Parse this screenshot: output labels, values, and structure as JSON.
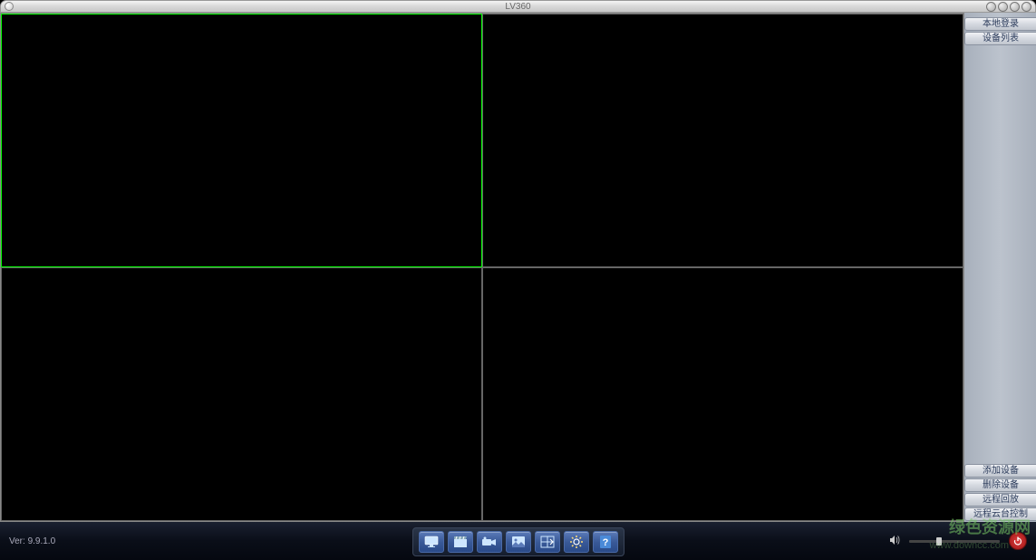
{
  "title": "LV360",
  "version_label": "Ver: 9.9.1.0",
  "sidebar": {
    "top": [
      {
        "label": "本地登录",
        "name": "local-login-button"
      },
      {
        "label": "设备列表",
        "name": "device-list-button"
      }
    ],
    "bottom": [
      {
        "label": "添加设备",
        "name": "add-device-button"
      },
      {
        "label": "删除设备",
        "name": "delete-device-button"
      },
      {
        "label": "远程回放",
        "name": "remote-playback-button"
      },
      {
        "label": "远程云台控制",
        "name": "remote-ptz-control-button"
      }
    ]
  },
  "toolbar": {
    "buttons": [
      {
        "name": "display-button",
        "icon": "monitor"
      },
      {
        "name": "record-button",
        "icon": "clapper"
      },
      {
        "name": "camera-button",
        "icon": "camera"
      },
      {
        "name": "snapshot-button",
        "icon": "image"
      },
      {
        "name": "layout-button",
        "icon": "layout"
      },
      {
        "name": "settings-button",
        "icon": "gear-light"
      },
      {
        "name": "help-button",
        "icon": "question"
      }
    ]
  },
  "watermark": {
    "text": "绿色资源网",
    "url": "www.downcc.com"
  }
}
